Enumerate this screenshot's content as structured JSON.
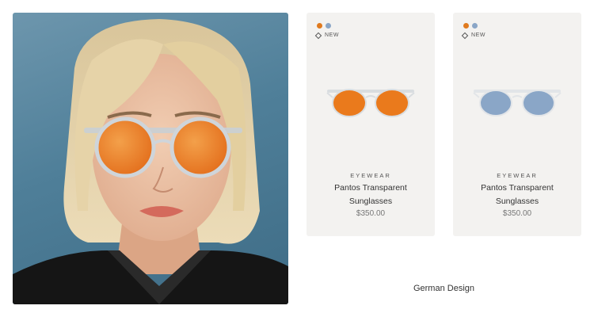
{
  "hero": {
    "icon": "model-wearing-sunglasses-photo"
  },
  "colors": {
    "orange": "#e07a1e",
    "blue": "#8aa6c7",
    "card_bg": "#f3f2f0"
  },
  "products": [
    {
      "new_label": "NEW",
      "category": "EYEWEAR",
      "name_line1": "Pantos Transparent",
      "name_line2": "Sunglasses",
      "price": "$350.00",
      "lens_color": "orange"
    },
    {
      "new_label": "NEW",
      "category": "EYEWEAR",
      "name_line1": "Pantos Transparent",
      "name_line2": "Sunglasses",
      "price": "$350.00",
      "lens_color": "blue"
    }
  ],
  "feature": {
    "title": "German Design"
  }
}
